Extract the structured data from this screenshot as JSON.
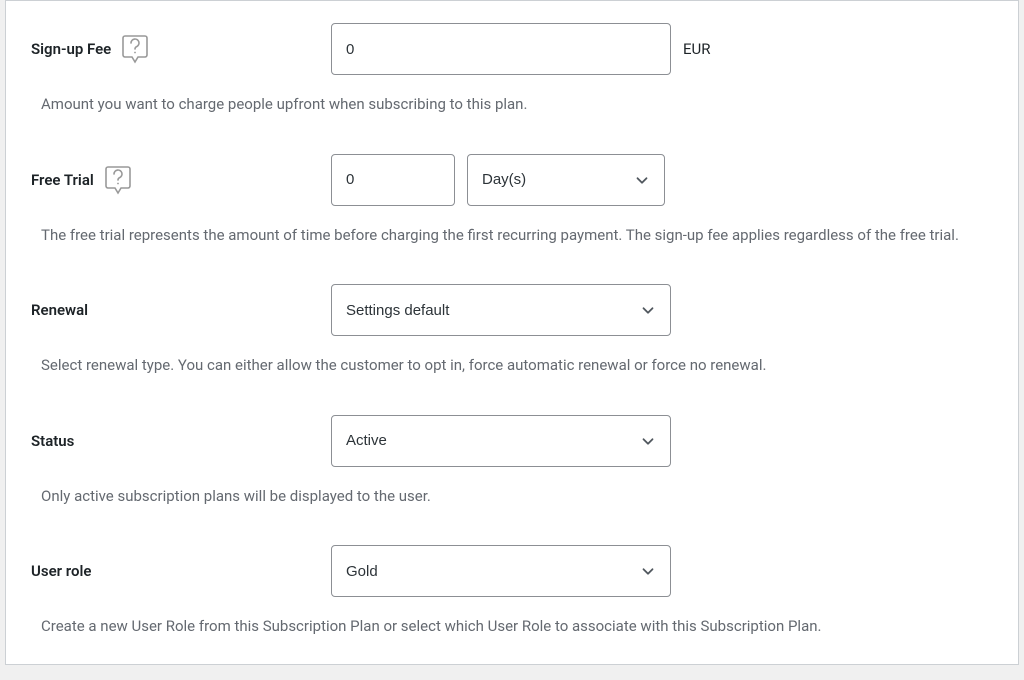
{
  "signup_fee": {
    "label": "Sign-up Fee",
    "value": "0",
    "currency": "EUR",
    "help": "Amount you want to charge people upfront when subscribing to this plan."
  },
  "free_trial": {
    "label": "Free Trial",
    "value": "0",
    "unit": "Day(s)",
    "help": "The free trial represents the amount of time before charging the first recurring payment. The sign-up fee applies regardless of the free trial."
  },
  "renewal": {
    "label": "Renewal",
    "value": "Settings default",
    "help": "Select renewal type. You can either allow the customer to opt in, force automatic renewal or force no renewal."
  },
  "status": {
    "label": "Status",
    "value": "Active",
    "help": "Only active subscription plans will be displayed to the user."
  },
  "user_role": {
    "label": "User role",
    "value": "Gold",
    "help": "Create a new User Role from this Subscription Plan or select which User Role to associate with this Subscription Plan."
  }
}
